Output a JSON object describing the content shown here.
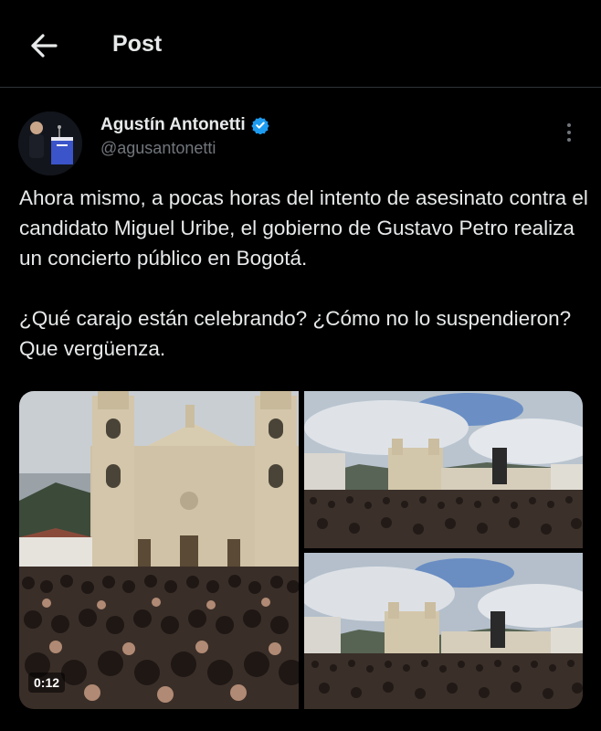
{
  "header": {
    "title": "Post",
    "back_icon": "arrow-left-icon"
  },
  "author": {
    "display_name": "Agustín Antonetti",
    "handle": "@agusantonetti",
    "verified_color": "#1d9bf0"
  },
  "post": {
    "text": "Ahora mismo, a pocas horas del intento de asesinato contra el candidato Miguel Uribe, el gobierno de Gustavo Petro realiza un concierto público en Bogotá.\n\n¿Qué carajo están celebrando? ¿Cómo no lo suspendieron? Que vergüenza."
  },
  "media": {
    "video_duration": "0:12",
    "items": [
      "video-cathedral-crowd",
      "photo-plaza-crowd-1",
      "photo-plaza-crowd-2"
    ]
  },
  "colors": {
    "background": "#000000",
    "text": "#e7e9ea",
    "muted": "#71767b",
    "divider": "#2f3336"
  }
}
